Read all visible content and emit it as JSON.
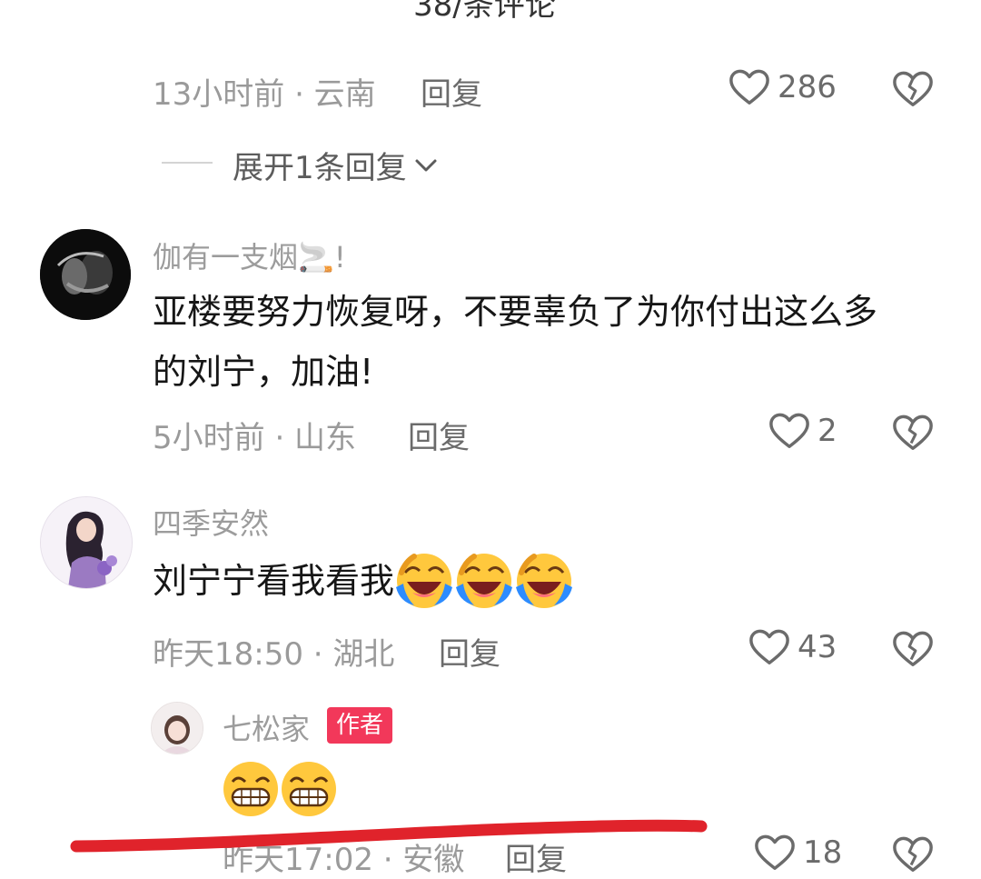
{
  "header": {
    "title_partial": "38/条评论"
  },
  "comments": [
    {
      "meta": "13小时前 · 云南",
      "reply_label": "回复",
      "likes": "286",
      "expand_label": "展开1条回复"
    },
    {
      "username": "伽有一支烟🚬!",
      "text_line1": "亚楼要努力恢复呀，不要辜负了为你付出这么多",
      "text_line2": "的刘宁，加油!",
      "meta": "5小时前 · 山东",
      "reply_label": "回复",
      "likes": "2"
    },
    {
      "username": "四季安然",
      "text": "刘宁宁看我看我",
      "emojis": [
        "laugh-cry-emoji",
        "laugh-cry-emoji",
        "laugh-cry-emoji"
      ],
      "meta": "昨天18:50 · 湖北",
      "reply_label": "回复",
      "likes": "43",
      "sub_reply": {
        "username": "七松家",
        "badge": "作者",
        "emojis": [
          "grin-emoji",
          "grin-emoji"
        ],
        "meta": "昨天17:02 · 安徽",
        "reply_label": "回复",
        "likes": "18"
      }
    }
  ],
  "colors": {
    "badge_bg": "#f2385a",
    "underline": "#e0232b",
    "meta_text": "#9a9a9a"
  }
}
